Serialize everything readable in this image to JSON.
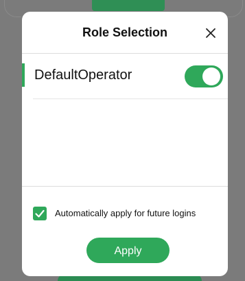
{
  "dialog": {
    "title": "Role Selection",
    "close_icon": "close-icon"
  },
  "roles": [
    {
      "label": "DefaultOperator",
      "enabled": true
    }
  ],
  "options": {
    "auto_apply_label": "Automatically apply for future logins",
    "auto_apply_checked": true
  },
  "actions": {
    "apply_label": "Apply"
  },
  "colors": {
    "accent": "#2fa85a",
    "backdrop": "#7b7b7b",
    "surface": "#ffffff"
  }
}
